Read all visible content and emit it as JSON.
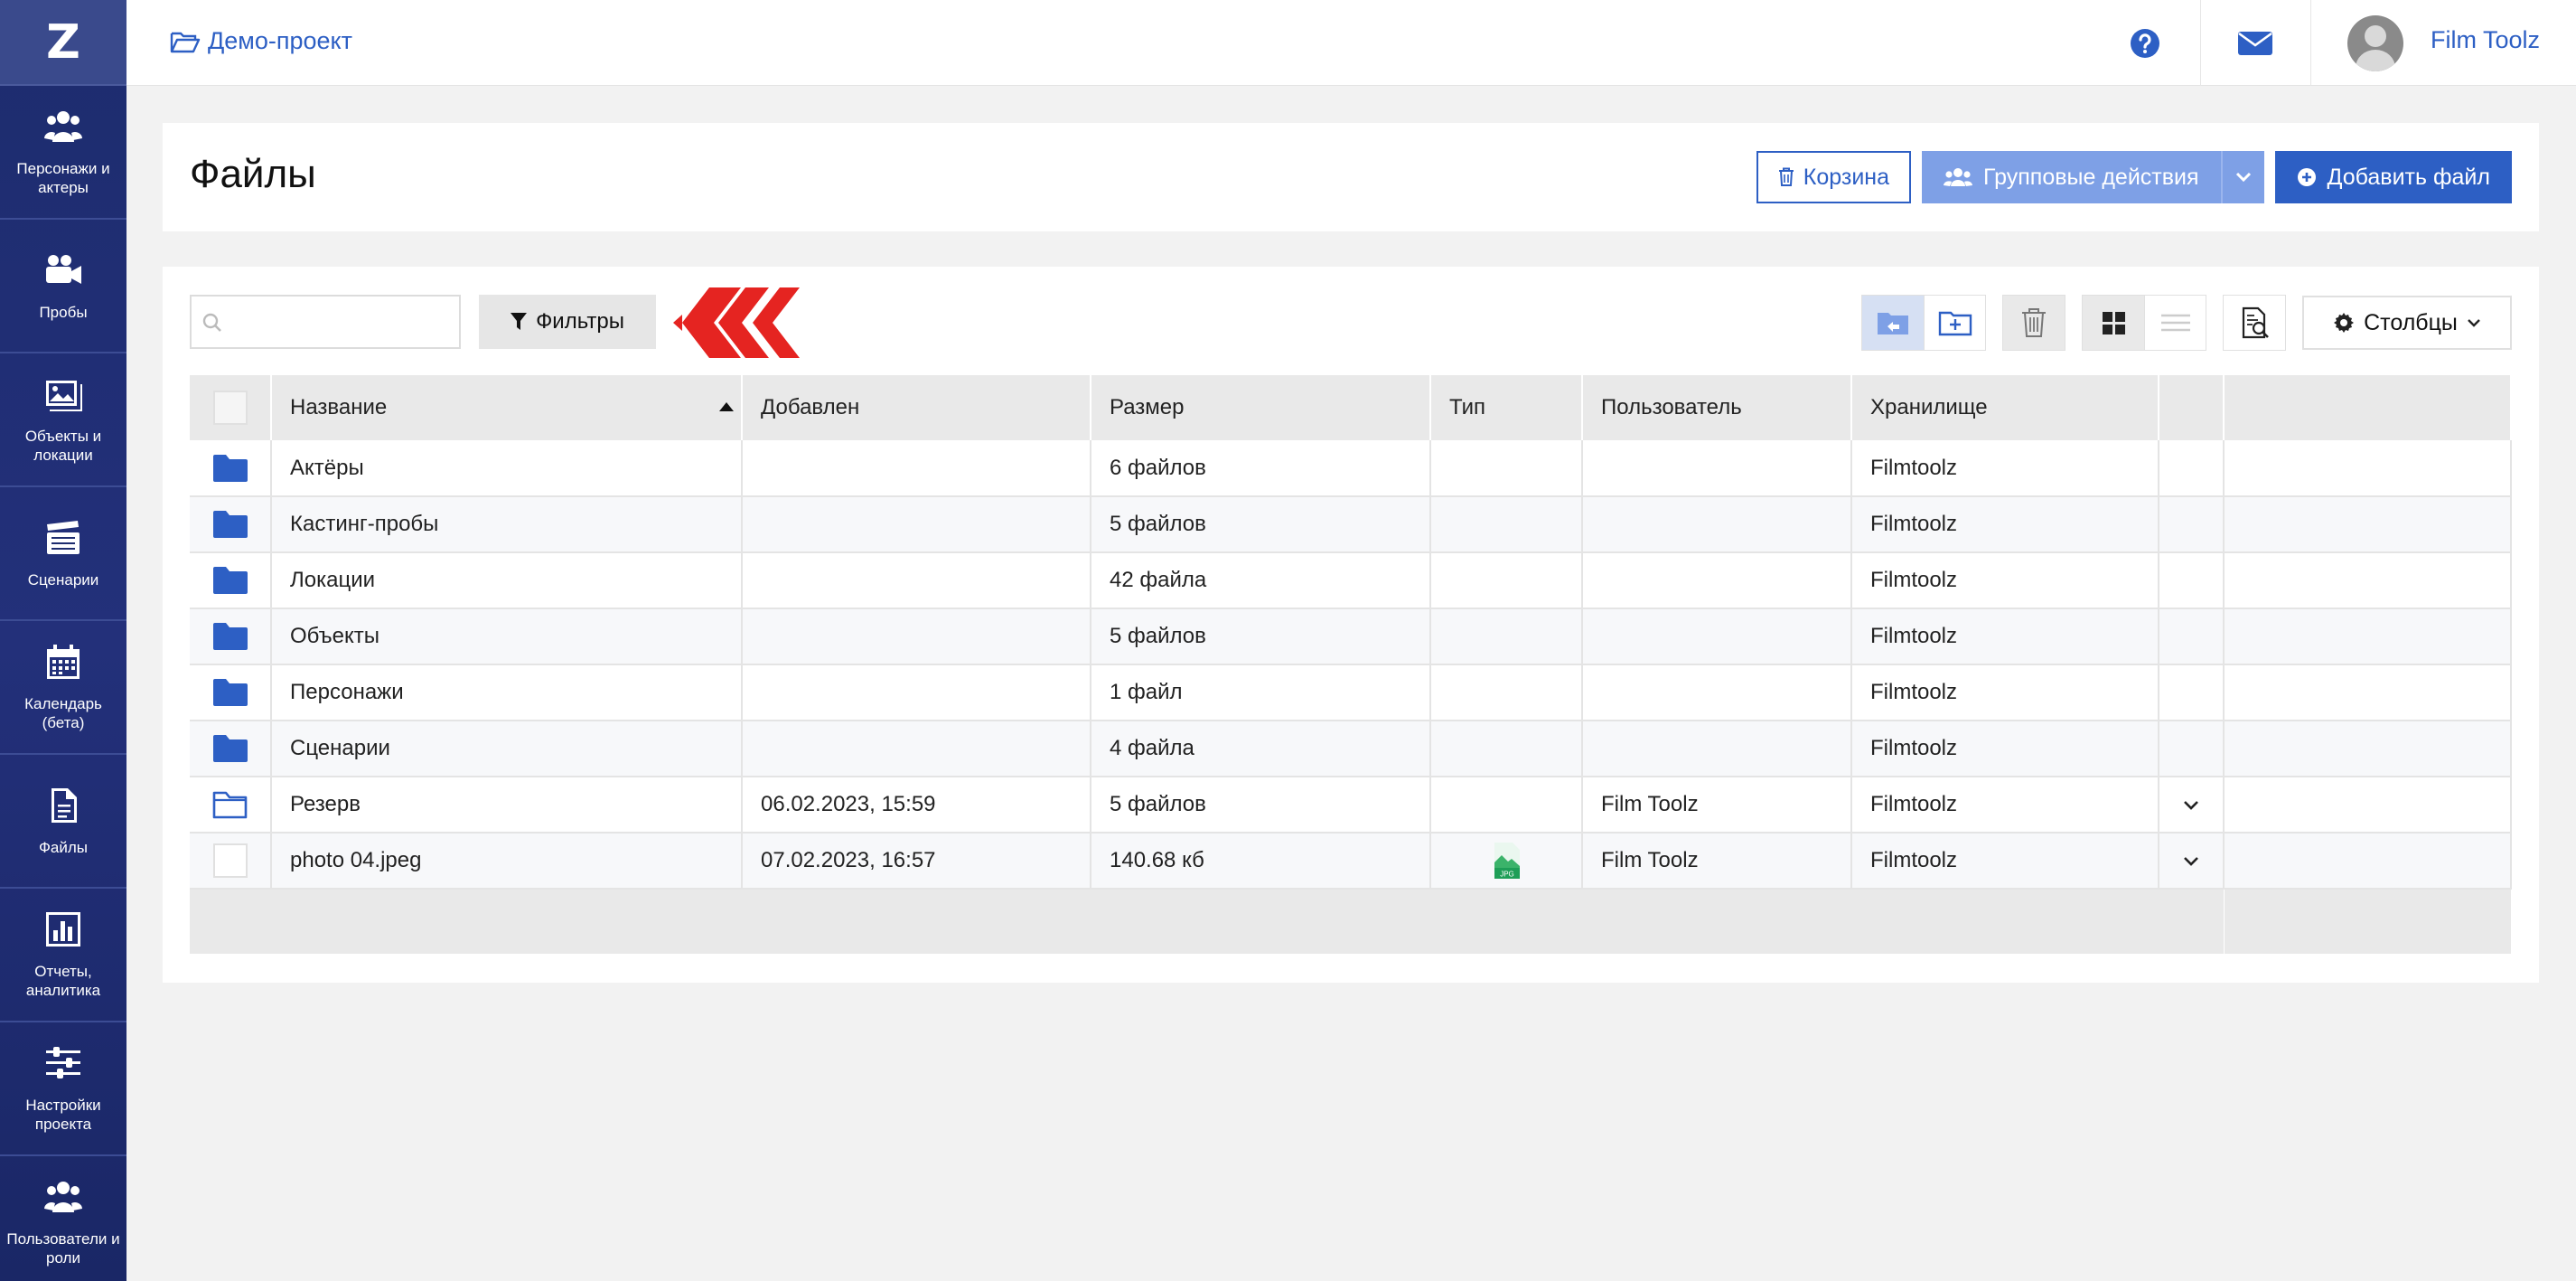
{
  "sidebar": {
    "logo": "Z",
    "items": [
      {
        "label": "Персонажи и актеры",
        "icon": "users-icon"
      },
      {
        "label": "Пробы",
        "icon": "video-camera-icon"
      },
      {
        "label": "Объекты и локации",
        "icon": "image-icon"
      },
      {
        "label": "Сценарии",
        "icon": "clapperboard-icon"
      },
      {
        "label": "Календарь (бета)",
        "icon": "calendar-icon"
      },
      {
        "label": "Файлы",
        "icon": "file-icon"
      },
      {
        "label": "Отчеты, аналитика",
        "icon": "chart-icon"
      },
      {
        "label": "Настройки проекта",
        "icon": "sliders-icon"
      },
      {
        "label": "Пользователи и роли",
        "icon": "users-icon"
      }
    ]
  },
  "topbar": {
    "project": "Демо-проект",
    "user_name": "Film Toolz"
  },
  "header": {
    "title": "Файлы",
    "trash_label": "Корзина",
    "group_actions_label": "Групповые действия",
    "add_file_label": "Добавить файл"
  },
  "toolbar": {
    "search_placeholder": "",
    "filters_label": "Фильтры",
    "columns_label": "Столбцы"
  },
  "table": {
    "columns": [
      "Название",
      "Добавлен",
      "Размер",
      "Тип",
      "Пользователь",
      "Хранилище"
    ],
    "rows": [
      {
        "kind": "folder",
        "name": "Актёры",
        "added": "",
        "size": "6 файлов",
        "type": "",
        "user": "",
        "storage": "Filmtoolz",
        "menu": false
      },
      {
        "kind": "folder",
        "name": "Кастинг-пробы",
        "added": "",
        "size": "5 файлов",
        "type": "",
        "user": "",
        "storage": "Filmtoolz",
        "menu": false
      },
      {
        "kind": "folder",
        "name": "Локации",
        "added": "",
        "size": "42 файла",
        "type": "",
        "user": "",
        "storage": "Filmtoolz",
        "menu": false
      },
      {
        "kind": "folder",
        "name": "Объекты",
        "added": "",
        "size": "5 файлов",
        "type": "",
        "user": "",
        "storage": "Filmtoolz",
        "menu": false
      },
      {
        "kind": "folder",
        "name": "Персонажи",
        "added": "",
        "size": "1 файл",
        "type": "",
        "user": "",
        "storage": "Filmtoolz",
        "menu": false
      },
      {
        "kind": "folder",
        "name": "Сценарии",
        "added": "",
        "size": "4 файла",
        "type": "",
        "user": "",
        "storage": "Filmtoolz",
        "menu": false
      },
      {
        "kind": "folder-open",
        "name": "Резерв",
        "added": "06.02.2023, 15:59",
        "size": "5 файлов",
        "type": "",
        "user": "Film Toolz",
        "storage": "Filmtoolz",
        "menu": true
      },
      {
        "kind": "file",
        "name": "photo 04.jpeg",
        "added": "07.02.2023, 16:57",
        "size": "140.68 кб",
        "type": "JPG",
        "user": "Film Toolz",
        "storage": "Filmtoolz",
        "menu": true
      }
    ]
  },
  "colors": {
    "primary": "#2d5fc4",
    "sidebar": "#1d2c6e",
    "accent_red": "#e52421"
  }
}
